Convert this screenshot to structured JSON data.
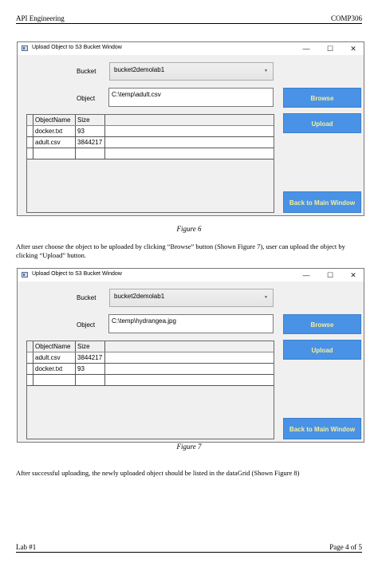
{
  "header": {
    "left": "API Engineering",
    "right": "COMP306"
  },
  "footer": {
    "left": "Lab #1",
    "right": "Page 4 of 5"
  },
  "window1": {
    "title": "Upload Object to S3 Bucket Window",
    "controls": {
      "minimize": "—",
      "maximize": "☐",
      "close": "✕"
    },
    "bucket_label": "Bucket",
    "bucket_value": "bucket2demolab1",
    "object_label": "Object",
    "object_value": "C:\\temp\\adult.csv",
    "browse_label": "Browse",
    "upload_label": "Upload",
    "back_label": "Back to Main Window",
    "columns": [
      "ObjectName",
      "Size"
    ],
    "rows": [
      {
        "name": "docker.txt",
        "size": "93"
      },
      {
        "name": "adult.csv",
        "size": "3844217"
      }
    ]
  },
  "caption1": "Figure 6",
  "paragraph1": "After user choose the object to be uploaded by clicking “Browse” button (Shown Figure 7), user can upload the object by clicking “Upload” button.",
  "window2": {
    "title": "Upload Object to S3 Bucket Window",
    "controls": {
      "minimize": "—",
      "maximize": "☐",
      "close": "✕"
    },
    "bucket_label": "Bucket",
    "bucket_value": "bucket2demolab1",
    "object_label": "Object",
    "object_value": "C:\\temp\\hydrangea.jpg",
    "browse_label": "Browse",
    "upload_label": "Upload",
    "back_label": "Back to Main Window",
    "columns": [
      "ObjectName",
      "Size"
    ],
    "rows": [
      {
        "name": "adult.csv",
        "size": "3844217"
      },
      {
        "name": "docker.txt",
        "size": "93"
      }
    ]
  },
  "caption2": "Figure 7",
  "paragraph2": "After successful uploading, the newly uploaded object should be listed in the dataGrid (Shown Figure 8)"
}
